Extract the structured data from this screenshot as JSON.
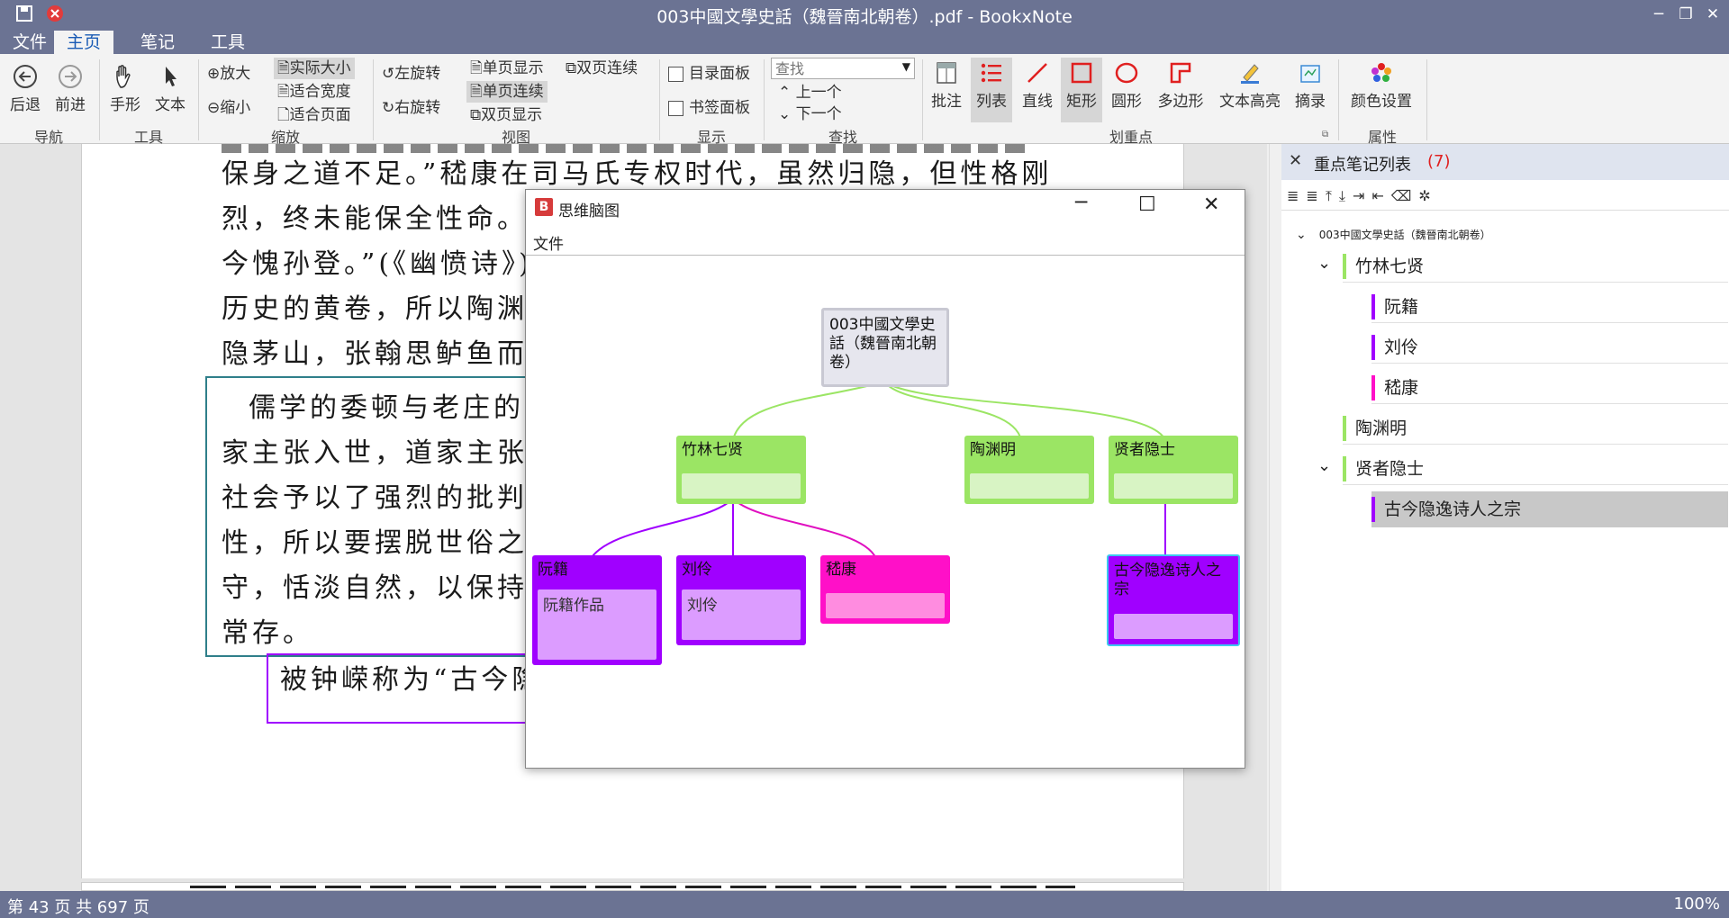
{
  "window": {
    "title": "003中國文學史話（魏晉南北朝卷）.pdf - BookxNote"
  },
  "menu": {
    "file": "文件",
    "home": "主页",
    "notes": "笔记",
    "tools": "工具"
  },
  "ribbon": {
    "back": "后退",
    "forward": "前进",
    "hand": "手形",
    "text": "文本",
    "zoom_in": "放大",
    "zoom_out": "缩小",
    "actual_size": "实际大小",
    "fit_width": "适合宽度",
    "fit_page": "适合页面",
    "rotate_left": "左旋转",
    "rotate_right": "右旋转",
    "single_page": "单页显示",
    "single_continuous": "单页连续",
    "double_page": "双页显示",
    "double_continuous": "双页连续",
    "toc_panel": "目录面板",
    "bookmark_panel": "书签面板",
    "search_placeholder": "查找",
    "prev": "上一个",
    "next": "下一个",
    "annotate": "批注",
    "list": "列表",
    "line": "直线",
    "rect": "矩形",
    "circle": "圆形",
    "polygon": "多边形",
    "highlight": "文本高亮",
    "excerpt": "摘录",
    "color_settings": "颜色设置",
    "groups": {
      "nav": "导航",
      "tools": "工具",
      "zoom": "缩放",
      "view": "视图",
      "display": "显示",
      "search": "查找",
      "mark": "划重点",
      "props": "属性"
    }
  },
  "pdf": {
    "lines": [
      "保身之道不足。”嵇康在司马氏专权时代，虽然归隐，但性格刚",
      "烈，终未能保全性命。",
      "今愧孙登。”(《幽愤诗》)",
      "历史的黄卷，所以陶渊明",
      "隐茅山，张翰思鲈鱼而去",
      "儒学的委顿与老庄的",
      "家主张入世，道家主张出",
      "社会予以了强烈的批判",
      "性，所以要摆脱世俗之累",
      "守，恬淡自然，以保持内",
      "常存。",
      "被钟嵘称为“古今隐"
    ]
  },
  "mindmap": {
    "title": "思维脑图",
    "menu_file": "文件",
    "root": "003中國文學史話（魏晉南北朝卷）",
    "nodes": {
      "zhulin": "竹林七贤",
      "tao": "陶渊明",
      "xianzhe": "贤者隐士",
      "ruanji": "阮籍",
      "ruanji_note": "阮籍作品",
      "liuling": "刘伶",
      "liuling_note": "刘伶",
      "jikang": "嵇康",
      "guji": "古今隐逸诗人之宗"
    }
  },
  "notes_panel": {
    "title": "重点笔记列表",
    "count": "(7)",
    "root": "003中國文學史話（魏晉南北朝卷）",
    "items": [
      "竹林七贤",
      "阮籍",
      "刘伶",
      "嵇康",
      "陶渊明",
      "贤者隐士",
      "古今隐逸诗人之宗"
    ]
  },
  "status": {
    "page": "第 43 页 共 697 页",
    "zoom": "100%"
  },
  "colors": {
    "chrome": "#6b7393",
    "green": "#9be564",
    "purple": "#a000ff",
    "magenta": "#ff10c8",
    "accent": "#1a5bb5"
  }
}
